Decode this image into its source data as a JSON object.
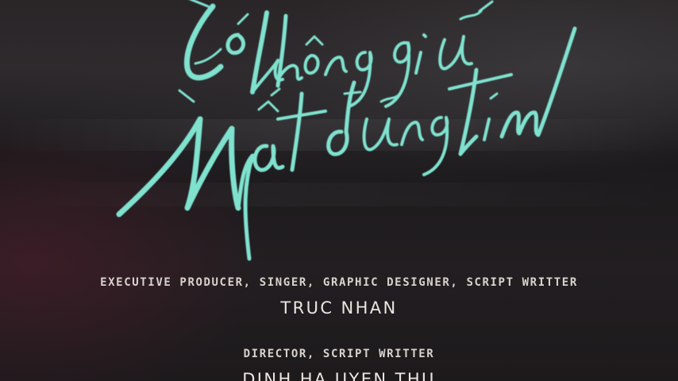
{
  "title_script": "Có không giữ mất đừng tìm",
  "colors": {
    "script_teal": "#7fe2cf",
    "credit_text": "#e2dcd8"
  },
  "credits": [
    {
      "role": "EXECUTIVE PRODUCER, SINGER, GRAPHIC DESIGNER, SCRIPT WRITTER",
      "name": "TRUC NHAN"
    },
    {
      "role": "DIRECTOR, SCRIPT WRITTER",
      "name": "DINH HA UYEN THU"
    }
  ]
}
